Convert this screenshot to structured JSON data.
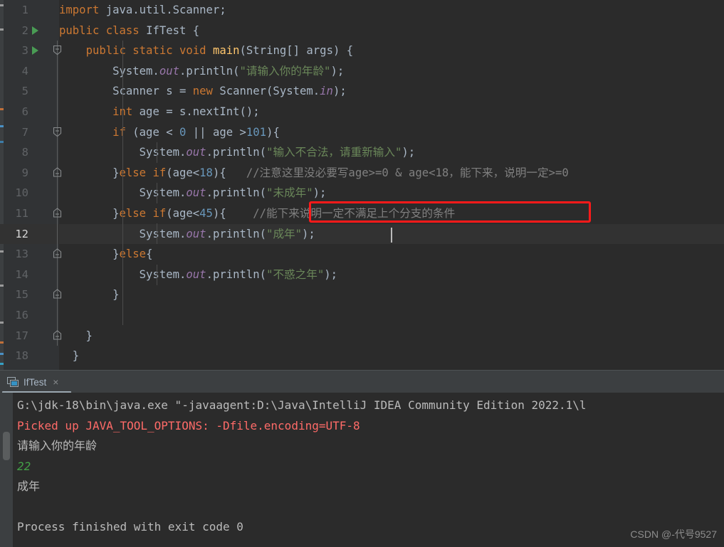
{
  "editor": {
    "lines": [
      {
        "num": "1",
        "run": false,
        "fold": "none",
        "tokens": [
          {
            "t": "kw",
            "s": "import "
          },
          {
            "t": "pln",
            "s": "java.util.Scanner;"
          }
        ]
      },
      {
        "num": "2",
        "run": true,
        "fold": "none",
        "tokens": [
          {
            "t": "kw",
            "s": "public class "
          },
          {
            "t": "pln",
            "s": "IfTest {"
          }
        ]
      },
      {
        "num": "3",
        "run": true,
        "fold": "start",
        "tokens": [
          {
            "t": "pln",
            "s": "    "
          },
          {
            "t": "kw",
            "s": "public static void "
          },
          {
            "t": "mth",
            "s": "main"
          },
          {
            "t": "pln",
            "s": "(String[] args) {"
          }
        ]
      },
      {
        "num": "4",
        "run": false,
        "fold": "none",
        "tokens": [
          {
            "t": "pln",
            "s": "        System."
          },
          {
            "t": "fld",
            "s": "out"
          },
          {
            "t": "pln",
            "s": ".println("
          },
          {
            "t": "str",
            "s": "\"请输入你的年龄\""
          },
          {
            "t": "pln",
            "s": ");"
          }
        ]
      },
      {
        "num": "5",
        "run": false,
        "fold": "none",
        "tokens": [
          {
            "t": "pln",
            "s": "        Scanner s = "
          },
          {
            "t": "kw",
            "s": "new "
          },
          {
            "t": "pln",
            "s": "Scanner(System."
          },
          {
            "t": "fld",
            "s": "in"
          },
          {
            "t": "pln",
            "s": ");"
          }
        ]
      },
      {
        "num": "6",
        "run": false,
        "fold": "none",
        "tokens": [
          {
            "t": "pln",
            "s": "        "
          },
          {
            "t": "kw",
            "s": "int "
          },
          {
            "t": "pln",
            "s": "age = s.nextInt();"
          }
        ]
      },
      {
        "num": "7",
        "run": false,
        "fold": "start",
        "tokens": [
          {
            "t": "pln",
            "s": "        "
          },
          {
            "t": "kw",
            "s": "if "
          },
          {
            "t": "pln",
            "s": "(age < "
          },
          {
            "t": "num",
            "s": "0"
          },
          {
            "t": "pln",
            "s": " || age >"
          },
          {
            "t": "num",
            "s": "101"
          },
          {
            "t": "pln",
            "s": "){"
          }
        ]
      },
      {
        "num": "8",
        "run": false,
        "fold": "none",
        "tokens": [
          {
            "t": "pln",
            "s": "            System."
          },
          {
            "t": "fld",
            "s": "out"
          },
          {
            "t": "pln",
            "s": ".println("
          },
          {
            "t": "str",
            "s": "\"输入不合法，请重新输入\""
          },
          {
            "t": "pln",
            "s": ");"
          }
        ]
      },
      {
        "num": "9",
        "run": false,
        "fold": "mid",
        "tokens": [
          {
            "t": "pln",
            "s": "        }"
          },
          {
            "t": "kw",
            "s": "else if"
          },
          {
            "t": "pln",
            "s": "(age<"
          },
          {
            "t": "num",
            "s": "18"
          },
          {
            "t": "pln",
            "s": "){   "
          },
          {
            "t": "cmt",
            "s": "//注意这里没必要写age>=0 & age<18，能下来，说明一定>=0"
          }
        ]
      },
      {
        "num": "10",
        "run": false,
        "fold": "none",
        "tokens": [
          {
            "t": "pln",
            "s": "            System."
          },
          {
            "t": "fld",
            "s": "out"
          },
          {
            "t": "pln",
            "s": ".println("
          },
          {
            "t": "str",
            "s": "\"未成年\""
          },
          {
            "t": "pln",
            "s": ");"
          }
        ]
      },
      {
        "num": "11",
        "run": false,
        "fold": "mid",
        "tokens": [
          {
            "t": "pln",
            "s": "        }"
          },
          {
            "t": "kw",
            "s": "else if"
          },
          {
            "t": "pln",
            "s": "(age<"
          },
          {
            "t": "num",
            "s": "45"
          },
          {
            "t": "pln",
            "s": "){    "
          },
          {
            "t": "cmt",
            "s": "//能下来说明一定不满足上个分支的条件"
          }
        ]
      },
      {
        "num": "12",
        "run": false,
        "fold": "none",
        "current": true,
        "tokens": [
          {
            "t": "pln",
            "s": "            System."
          },
          {
            "t": "fld",
            "s": "out"
          },
          {
            "t": "pln",
            "s": ".println("
          },
          {
            "t": "str",
            "s": "\"成年\""
          },
          {
            "t": "pln",
            "s": ");"
          }
        ]
      },
      {
        "num": "13",
        "run": false,
        "fold": "mid",
        "tokens": [
          {
            "t": "pln",
            "s": "        }"
          },
          {
            "t": "kw",
            "s": "else"
          },
          {
            "t": "pln",
            "s": "{"
          }
        ]
      },
      {
        "num": "14",
        "run": false,
        "fold": "none",
        "tokens": [
          {
            "t": "pln",
            "s": "            System."
          },
          {
            "t": "fld",
            "s": "out"
          },
          {
            "t": "pln",
            "s": ".println("
          },
          {
            "t": "str",
            "s": "\"不惑之年\""
          },
          {
            "t": "pln",
            "s": ");"
          }
        ]
      },
      {
        "num": "15",
        "run": false,
        "fold": "end",
        "tokens": [
          {
            "t": "pln",
            "s": "        }"
          }
        ]
      },
      {
        "num": "16",
        "run": false,
        "fold": "none",
        "tokens": []
      },
      {
        "num": "17",
        "run": false,
        "fold": "end",
        "tokens": [
          {
            "t": "pln",
            "s": "    }"
          }
        ]
      },
      {
        "num": "18",
        "run": false,
        "fold": "none",
        "tokens": [
          {
            "t": "pln",
            "s": "  }"
          }
        ]
      }
    ],
    "annotation": {
      "label": "red-highlight-box",
      "color": "#ff1a1a"
    }
  },
  "run_window": {
    "tab": {
      "label": "IfTest",
      "close_label": "×",
      "icon": "console-icon"
    },
    "console": {
      "lines": [
        {
          "color": "white",
          "text": "G:\\jdk-18\\bin\\java.exe \"-javaagent:D:\\Java\\IntelliJ IDEA Community Edition 2022.1\\l"
        },
        {
          "color": "red",
          "text": "Picked up JAVA_TOOL_OPTIONS: -Dfile.encoding=UTF-8"
        },
        {
          "color": "white",
          "text": "请输入你的年龄"
        },
        {
          "color": "green",
          "text": "22"
        },
        {
          "color": "white",
          "text": "成年"
        },
        {
          "color": "white",
          "text": ""
        },
        {
          "color": "white",
          "text": "Process finished with exit code 0"
        }
      ]
    }
  },
  "watermark": {
    "text": "CSDN @-代号9527"
  },
  "colors": {
    "background": "#2b2b2b",
    "gutter": "#313335",
    "keyword": "#cc7832",
    "string": "#6a8759",
    "number": "#6897bb",
    "comment": "#808080",
    "static_field": "#9876aa",
    "plain": "#a9b7c6",
    "method": "#ffc66d",
    "accent_red": "#ff1a1a",
    "run_green": "#499c54"
  }
}
